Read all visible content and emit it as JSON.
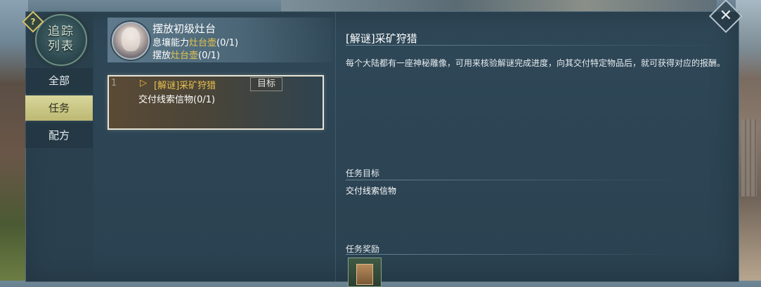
{
  "badge": {
    "text": "追踪\n列表",
    "help": "?"
  },
  "tabs": [
    {
      "label": "全部"
    },
    {
      "label": "任务"
    },
    {
      "label": "配方"
    }
  ],
  "current_quest": {
    "title": "摆放初级灶台",
    "line1_prefix": "息壤能力",
    "line1_highlight": "灶台壶",
    "line1_suffix": "(0/1)",
    "line2_prefix": "摆放",
    "line2_highlight": "灶台壶",
    "line2_suffix": "(0/1)"
  },
  "selected_quest": {
    "index": "1",
    "arrow": "▷",
    "title": "[解谜]采矿狩猎",
    "tag": "目标",
    "objective": "交付线索信物(0/1)"
  },
  "detail": {
    "title": "[解谜]采矿狩猎",
    "description": "每个大陆都有一座神秘雕像，可用来核验解谜完成进度，向其交付特定物品后，就可获得对应的报酬。",
    "objective_header": "任务目标",
    "objective_text": "交付线索信物",
    "reward_header": "任务奖励"
  },
  "close": {
    "symbol": "✕"
  }
}
